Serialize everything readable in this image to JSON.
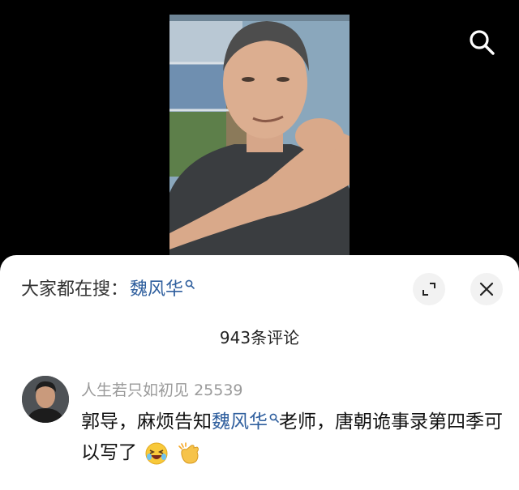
{
  "video": {
    "search_icon": "search-icon"
  },
  "panel": {
    "search_prefix": "大家都在搜：",
    "search_keyword": "魏风华",
    "keyword_icon": "search-icon",
    "expand_icon": "expand-icon",
    "close_icon": "close-icon",
    "comment_count": "943条评论"
  },
  "comment": {
    "username": "人生若只如初见",
    "user_number": "25539",
    "text_before": "郭导，麻烦告知",
    "mention": "魏风华",
    "text_after": "老师，唐朝诡事录第四季可以写了",
    "emojis": [
      "laughing-face-icon",
      "clapping-hands-icon"
    ]
  },
  "colors": {
    "link": "#2f5f9e",
    "muted": "#9a9a9a",
    "background": "#000000",
    "sheet": "#ffffff"
  }
}
